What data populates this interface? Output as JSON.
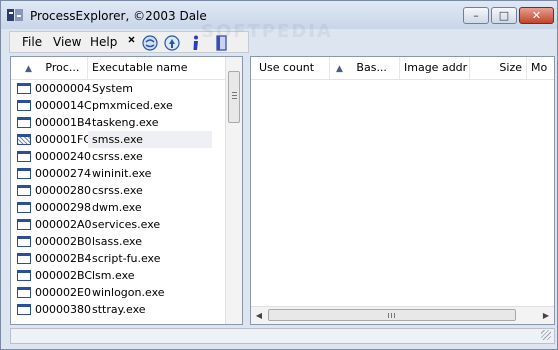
{
  "window": {
    "title": "ProcessExplorer, ©2003 Dale",
    "buttons": {
      "minimize": "–",
      "maximize": "□",
      "close": "✕"
    }
  },
  "menu": [
    "File",
    "View",
    "Help"
  ],
  "toolbar": [
    {
      "icon": "close-icon"
    },
    {
      "icon": "refresh-icon"
    },
    {
      "icon": "find-icon"
    },
    {
      "icon": "info-icon"
    },
    {
      "icon": "window-icon"
    }
  ],
  "process_list": {
    "columns": [
      "Proc...",
      "Executable name"
    ],
    "rows": [
      {
        "pid": "00000004",
        "name": "System"
      },
      {
        "pid": "0000014C",
        "name": "pmxmiced.exe"
      },
      {
        "pid": "000001B4",
        "name": "taskeng.exe"
      },
      {
        "pid": "000001FC",
        "name": "smss.exe",
        "selected": true
      },
      {
        "pid": "00000240",
        "name": "csrss.exe"
      },
      {
        "pid": "00000274",
        "name": "wininit.exe"
      },
      {
        "pid": "00000280",
        "name": "csrss.exe"
      },
      {
        "pid": "00000298",
        "name": "dwm.exe"
      },
      {
        "pid": "000002A0",
        "name": "services.exe"
      },
      {
        "pid": "000002B0",
        "name": "lsass.exe"
      },
      {
        "pid": "000002B4",
        "name": "script-fu.exe"
      },
      {
        "pid": "000002BC",
        "name": "lsm.exe"
      },
      {
        "pid": "000002E0",
        "name": "winlogon.exe"
      },
      {
        "pid": "00000380",
        "name": "sttray.exe"
      }
    ]
  },
  "module_list": {
    "columns": [
      "Use count",
      "Bas...",
      "Image addr",
      "Size",
      "Mo"
    ]
  },
  "watermark": "SOFTPEDIA"
}
